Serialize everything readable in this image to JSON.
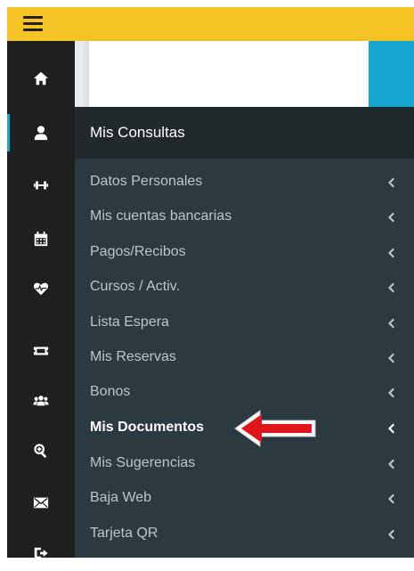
{
  "panel": {
    "title": "Mis Consultas"
  },
  "menu": {
    "items": [
      {
        "label": "Datos Personales"
      },
      {
        "label": "Mis cuentas bancarias"
      },
      {
        "label": "Pagos/Recibos"
      },
      {
        "label": "Cursos / Activ."
      },
      {
        "label": "Lista Espera"
      },
      {
        "label": "Mis Reservas"
      },
      {
        "label": "Bonos"
      },
      {
        "label": "Mis Documentos",
        "highlighted": true
      },
      {
        "label": "Mis Sugerencias"
      },
      {
        "label": "Baja Web"
      },
      {
        "label": "Tarjeta QR"
      }
    ]
  },
  "icons": [
    "home-icon",
    "user-icon",
    "dumbbell-icon",
    "calendar-icon",
    "heartbeat-icon",
    "ticket-icon",
    "users-icon",
    "search-plus-icon",
    "envelope-icon",
    "sign-out-icon"
  ],
  "colors": {
    "topbar": "#f5c326",
    "iconbar": "#1d1f21",
    "panel_header": "#22292d",
    "panel": "#2b3a40",
    "menu_text": "#b8c7ce",
    "accent_blue": "#1aa7cf",
    "annotation_arrow": "#e0141a"
  }
}
